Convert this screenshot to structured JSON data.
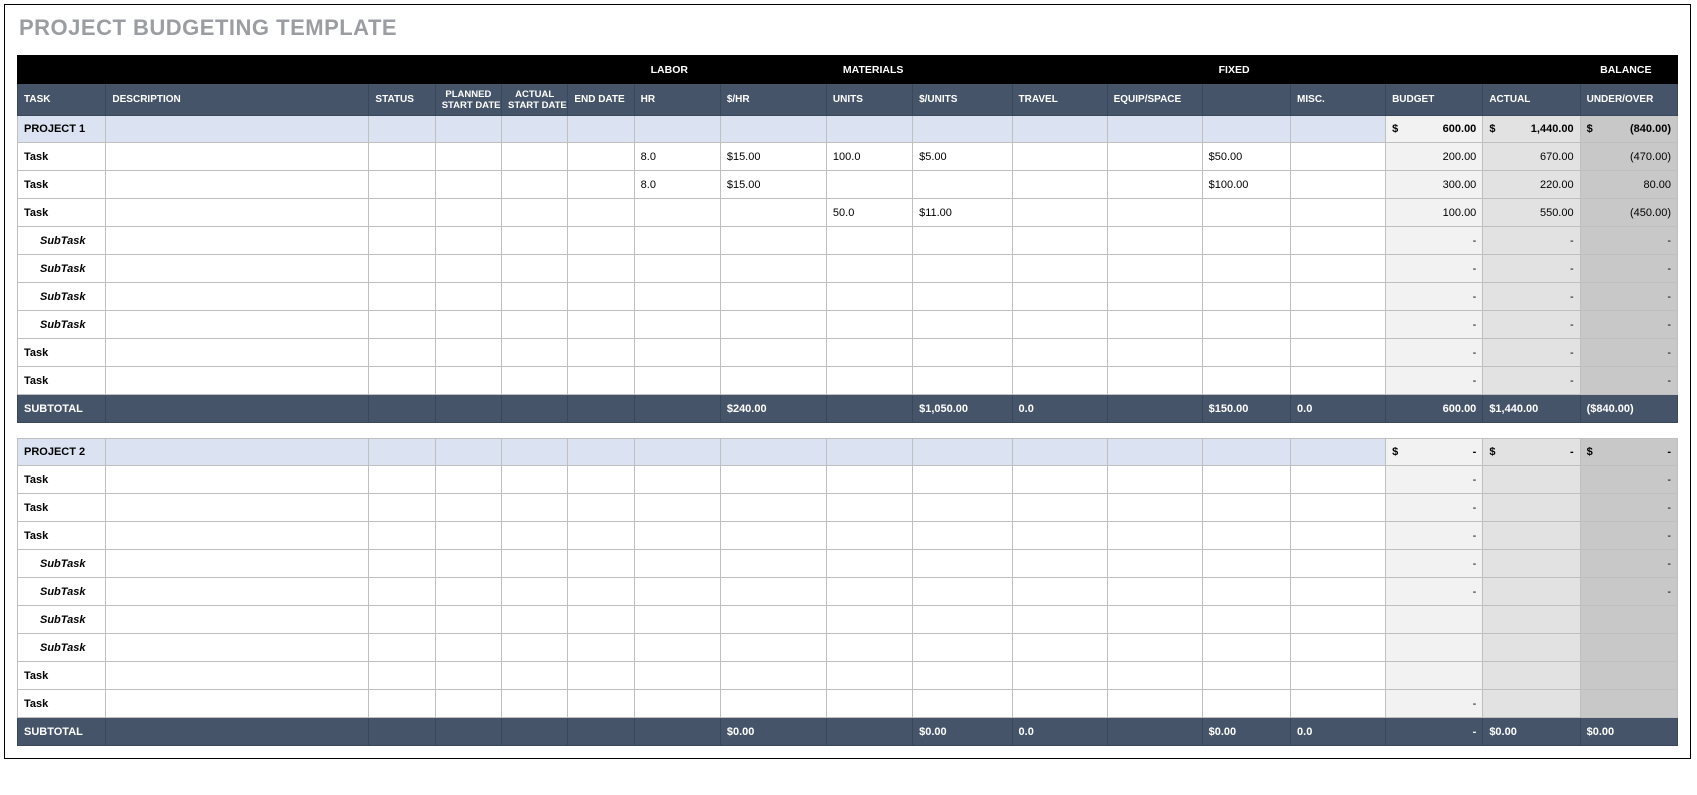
{
  "title": "PROJECT BUDGETING TEMPLATE",
  "header_groups": {
    "labor": "LABOR",
    "materials": "MATERIALS",
    "fixed": "FIXED",
    "balance": "BALANCE"
  },
  "columns": {
    "task": "TASK",
    "description": "DESCRIPTION",
    "status": "STATUS",
    "planned_start": "PLANNED START DATE",
    "actual_start": "ACTUAL START DATE",
    "end_date": "END DATE",
    "hr": "HR",
    "dollar_hr": "$/HR",
    "units": "UNITS",
    "dollar_units": "$/UNITS",
    "travel": "TRAVEL",
    "equip": "EQUIP/SPACE",
    "fixed_blank": "",
    "misc": "MISC.",
    "budget": "BUDGET",
    "actual": "ACTUAL",
    "under_over": "UNDER/OVER"
  },
  "projects": [
    {
      "name": "PROJECT 1",
      "summary": {
        "budget_prefix": "$",
        "budget": "600.00",
        "actual_prefix": "$",
        "actual": "1,440.00",
        "uo_prefix": "$",
        "uo": "(840.00)"
      },
      "rows": [
        {
          "type": "task",
          "task": "Task",
          "hr": "8.0",
          "shr": "$15.00",
          "units": "100.0",
          "sunits": "$5.00",
          "fixed": "$50.00",
          "budget": "200.00",
          "actual": "670.00",
          "uo": "(470.00)"
        },
        {
          "type": "task",
          "task": "Task",
          "hr": "8.0",
          "shr": "$15.00",
          "units": "",
          "sunits": "",
          "fixed": "$100.00",
          "budget": "300.00",
          "actual": "220.00",
          "uo": "80.00"
        },
        {
          "type": "task",
          "task": "Task",
          "hr": "",
          "shr": "",
          "units": "50.0",
          "sunits": "$11.00",
          "fixed": "",
          "budget": "100.00",
          "actual": "550.00",
          "uo": "(450.00)"
        },
        {
          "type": "sub",
          "task": "SubTask",
          "budget": "-",
          "actual": "-",
          "uo": "-"
        },
        {
          "type": "sub",
          "task": "SubTask",
          "budget": "-",
          "actual": "-",
          "uo": "-"
        },
        {
          "type": "sub",
          "task": "SubTask",
          "budget": "-",
          "actual": "-",
          "uo": "-"
        },
        {
          "type": "sub",
          "task": "SubTask",
          "budget": "-",
          "actual": "-",
          "uo": "-"
        },
        {
          "type": "task",
          "task": "Task",
          "budget": "-",
          "actual": "-",
          "uo": "-"
        },
        {
          "type": "task",
          "task": "Task",
          "budget": "-",
          "actual": "-",
          "uo": "-"
        }
      ],
      "subtotal": {
        "label": "SUBTOTAL",
        "shr": "$240.00",
        "sunits": "$1,050.00",
        "travel": "0.0",
        "fixed": "$150.00",
        "misc": "0.0",
        "budget": "600.00",
        "actual": "$1,440.00",
        "uo": "($840.00)"
      }
    },
    {
      "name": "PROJECT 2",
      "summary": {
        "budget_prefix": "$",
        "budget": "-",
        "actual_prefix": "$",
        "actual": "-",
        "uo_prefix": "$",
        "uo": "-"
      },
      "rows": [
        {
          "type": "task",
          "task": "Task",
          "budget": "-",
          "actual": "",
          "uo": "-"
        },
        {
          "type": "task",
          "task": "Task",
          "budget": "-",
          "actual": "",
          "uo": "-"
        },
        {
          "type": "task",
          "task": "Task",
          "budget": "-",
          "actual": "",
          "uo": "-"
        },
        {
          "type": "sub",
          "task": "SubTask",
          "budget": "-",
          "actual": "",
          "uo": "-"
        },
        {
          "type": "sub",
          "task": "SubTask",
          "budget": "-",
          "actual": "",
          "uo": "-"
        },
        {
          "type": "sub",
          "task": "SubTask",
          "budget": "",
          "actual": "",
          "uo": ""
        },
        {
          "type": "sub",
          "task": "SubTask",
          "budget": "",
          "actual": "",
          "uo": ""
        },
        {
          "type": "task",
          "task": "Task",
          "budget": "",
          "actual": "",
          "uo": ""
        },
        {
          "type": "task",
          "task": "Task",
          "budget": "-",
          "actual": "",
          "uo": ""
        }
      ],
      "subtotal": {
        "label": "SUBTOTAL",
        "shr": "$0.00",
        "sunits": "$0.00",
        "travel": "0.0",
        "fixed": "$0.00",
        "misc": "0.0",
        "budget": "-",
        "actual": "$0.00",
        "uo": "$0.00"
      }
    }
  ]
}
